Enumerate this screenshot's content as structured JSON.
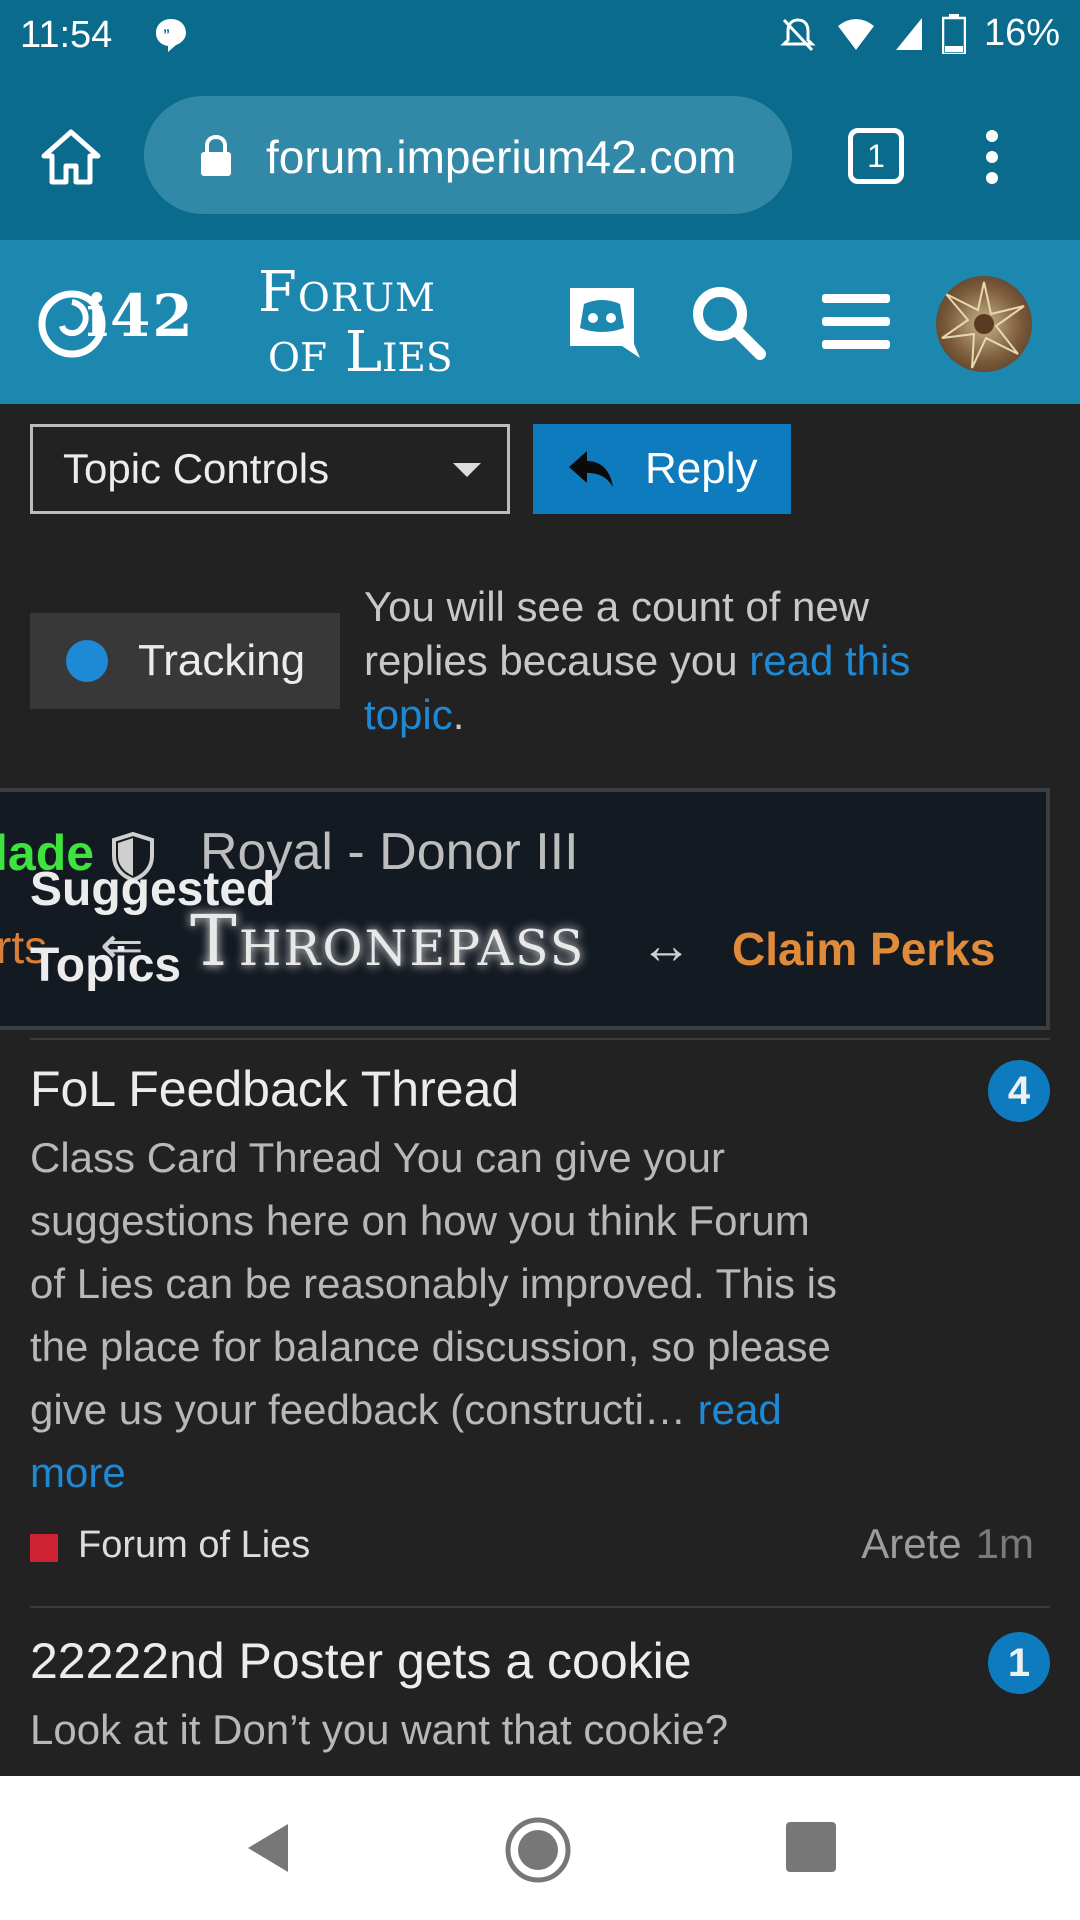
{
  "status_bar": {
    "time": "11:54",
    "battery": "16%"
  },
  "browser": {
    "url": "forum.imperium42.com",
    "tab_count": "1"
  },
  "header": {
    "logo_main": "i42",
    "logo_forum_line1": "Forum",
    "logo_forum_line2": "of Lies"
  },
  "controls": {
    "topic_controls_label": "Topic Controls",
    "reply_label": "Reply"
  },
  "tracking": {
    "label": "Tracking",
    "desc_prefix": "You will see a count of new replies because you ",
    "desc_link": "read this topic",
    "desc_suffix": "."
  },
  "banner": {
    "name_fragment": "lade",
    "role": "Royal - Donor III",
    "left_fragment": "rts",
    "arrow": "⇐",
    "thronepass": "Thronepass",
    "arrow2": "↔",
    "claim": "Claim Perks"
  },
  "suggested_heading": "Suggested Topics",
  "topics": [
    {
      "title": "FoL Feedback Thread",
      "badge": "4",
      "excerpt": "Class Card Thread You can give your suggestions here on how you think Forum of Lies can be reasonably improved. This is the place for balance discussion, so please give us your feedback (constructi… ",
      "read_more": "read more",
      "category": "Forum of Lies",
      "poster": "Arete",
      "age": "1m"
    },
    {
      "title": "22222nd Poster gets a cookie",
      "badge": "1",
      "excerpt": "Look at it Don’t you want that cookie?"
    }
  ],
  "colors": {
    "accent": "#0e7bbf",
    "header_bg": "#1c88b0",
    "statusbar_bg": "#0a6b8c",
    "category": "#cc2233"
  }
}
